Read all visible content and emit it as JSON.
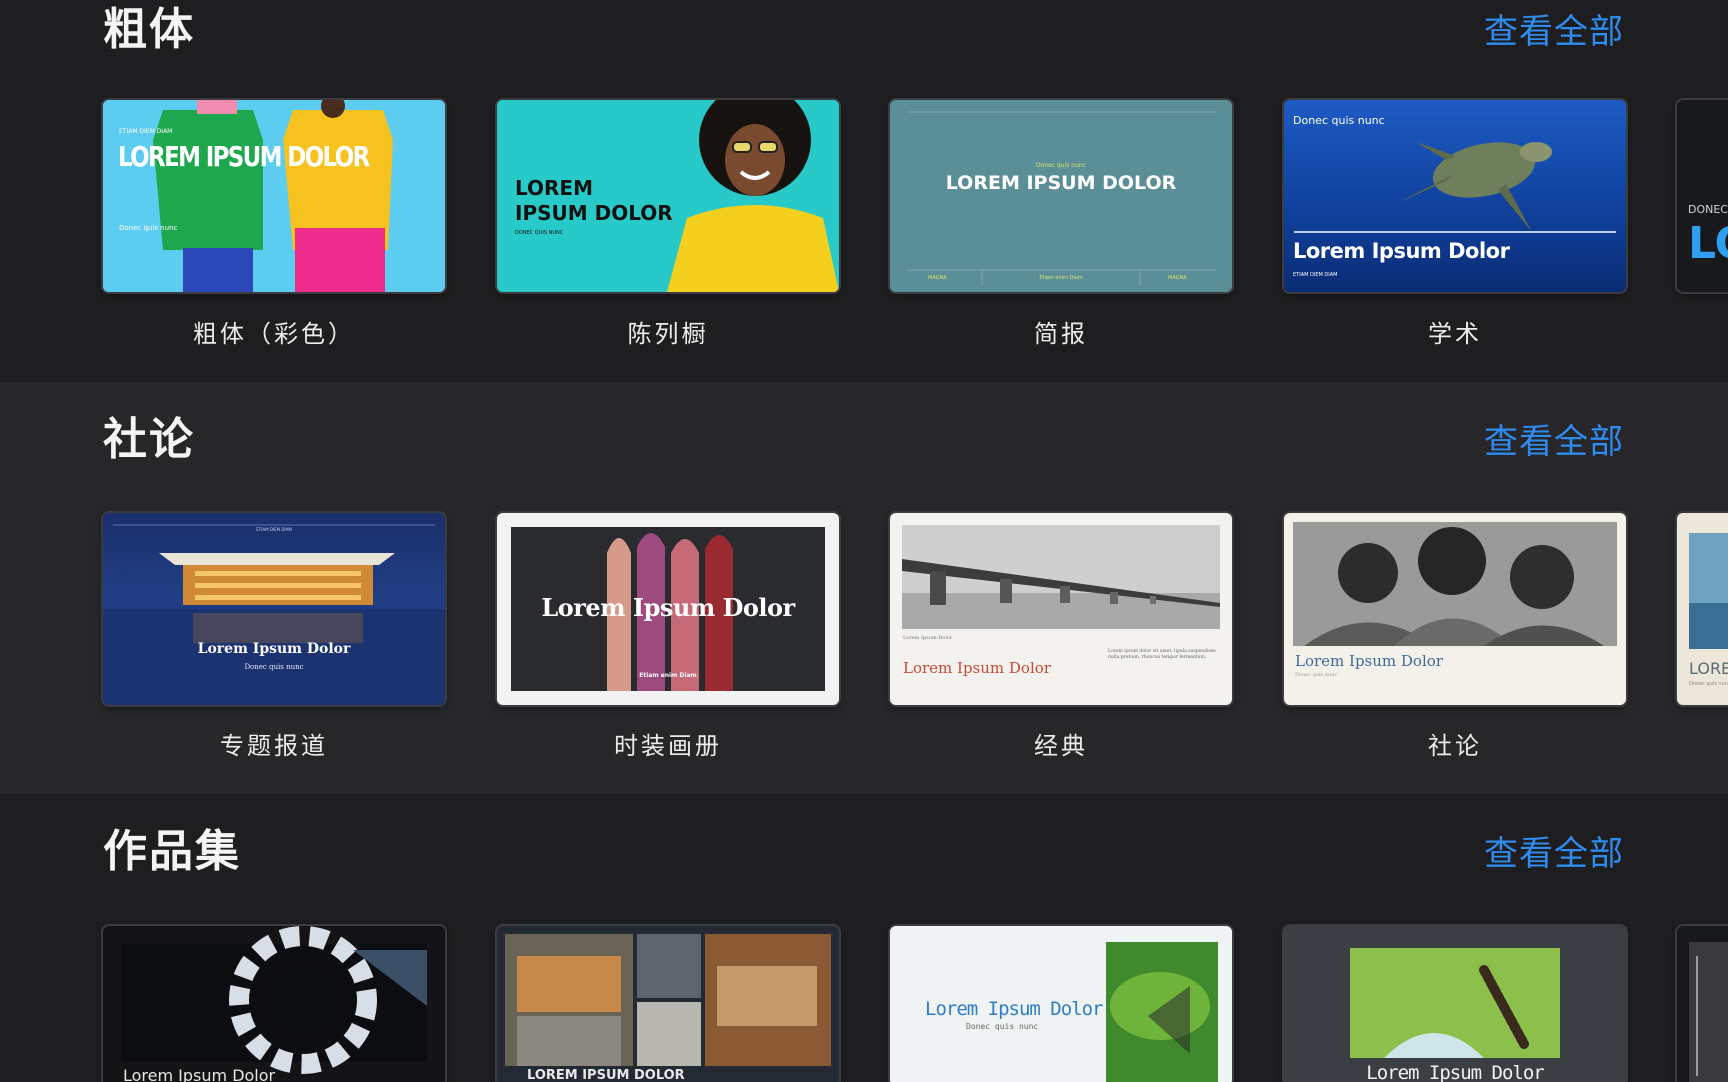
{
  "sections": [
    {
      "title": "粗体",
      "see_all": "查看全部",
      "templates": [
        {
          "label": "粗体（彩色）",
          "thumb": {
            "small": "ETIAM DIEM DIAM",
            "headline": "LOREM IPSUM DOLOR",
            "sub": "Donec quis nunc"
          }
        },
        {
          "label": "陈列橱",
          "thumb": {
            "headline_1": "LOREM",
            "headline_2": "IPSUM DOLOR",
            "sub": "DONEC QUIS NUNC"
          }
        },
        {
          "label": "简报",
          "thumb": {
            "small": "Donec quis nunc",
            "headline": "LOREM IPSUM DOLOR",
            "footer_left": "MAGNA",
            "footer_mid": "Etiam enim Diam",
            "footer_right": "MAGNA"
          }
        },
        {
          "label": "学术",
          "thumb": {
            "small": "Donec quis nunc",
            "headline": "Lorem Ipsum Dolor",
            "sub": "ETIAM DIEM DIAM"
          }
        }
      ],
      "peek": {
        "small": "DONEC",
        "headline": "LO"
      }
    },
    {
      "title": "社论",
      "see_all": "查看全部",
      "templates": [
        {
          "label": "专题报道",
          "thumb": {
            "small": "ETIAM DIEM DIAM",
            "headline": "Lorem Ipsum Dolor",
            "sub": "Donec quis nunc"
          }
        },
        {
          "label": "时装画册",
          "thumb": {
            "headline": "Lorem Ipsum Dolor",
            "sub": "Etiam enim Diam"
          }
        },
        {
          "label": "经典",
          "thumb": {
            "small": "Lorem Ipsum Dolor",
            "headline": "Lorem Ipsum Dolor",
            "body": "Lorem ipsum dolor sit amet, ligula suspendisse nulla pretium, rhoncus tempor fermentum."
          }
        },
        {
          "label": "社论",
          "thumb": {
            "headline": "Lorem Ipsum Dolor",
            "sub": "Donec quis nunc"
          }
        }
      ],
      "peek": {
        "headline": "LORE",
        "sub": "Donec quis nun"
      }
    },
    {
      "title": "作品集",
      "see_all": "查看全部",
      "templates": [
        {
          "thumb": {
            "headline": "Lorem Ipsum Dolor"
          }
        },
        {
          "thumb": {
            "headline": "LOREM IPSUM DOLOR"
          }
        },
        {
          "thumb": {
            "headline": "Lorem Ipsum Dolor",
            "sub": "Donec quis nunc"
          }
        },
        {
          "thumb": {
            "headline": "Lorem Ipsum Dolor"
          }
        }
      ]
    }
  ],
  "colors": {
    "background": "#1e1e20",
    "band": "#27272a",
    "accent": "#2e8cf0",
    "title": "#f4f4f4",
    "label": "#ececec"
  }
}
